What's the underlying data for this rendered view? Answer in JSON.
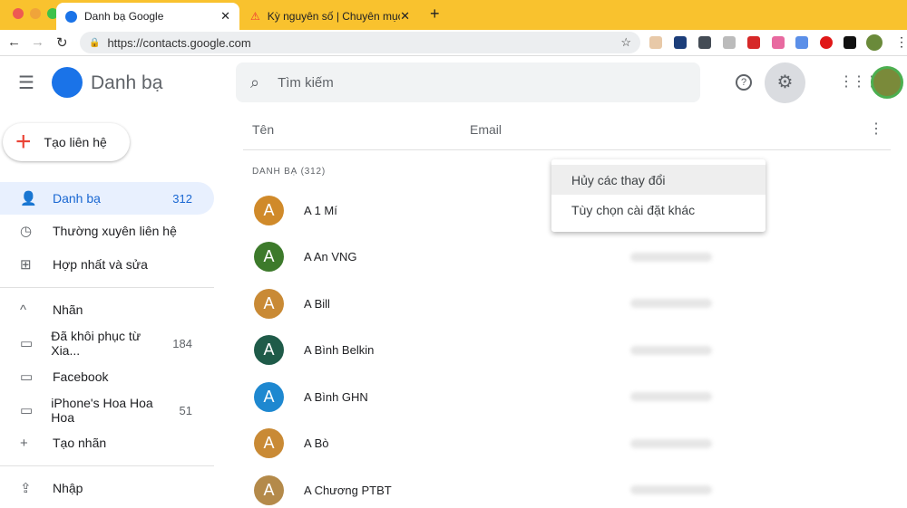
{
  "browser": {
    "tabs": [
      {
        "title": "Danh bạ Google",
        "active": true
      },
      {
        "title": "Kỳ nguyên số | Chuyên mục CN",
        "active": false
      }
    ],
    "url": "https://contacts.google.com"
  },
  "app": {
    "title": "Danh bạ",
    "search_placeholder": "Tìm kiếm",
    "create_label": "Tạo liên hệ"
  },
  "sidebar": {
    "items": [
      {
        "label": "Danh bạ",
        "count": "312",
        "icon": "person-icon"
      },
      {
        "label": "Thường xuyên liên hệ",
        "icon": "history-icon"
      },
      {
        "label": "Hợp nhất và sửa",
        "icon": "merge-icon"
      }
    ],
    "labels_header": "Nhãn",
    "labels": [
      {
        "label": "Đã khôi phục từ Xia...",
        "count": "184"
      },
      {
        "label": "Facebook"
      },
      {
        "label": "iPhone's Hoa Hoa Hoa",
        "count": "51"
      }
    ],
    "create_label": "Tạo nhãn",
    "import": "Nhập"
  },
  "table": {
    "col_name": "Tên",
    "col_email": "Email",
    "section": "DANH BẠ (312)",
    "contacts": [
      {
        "name": "A 1 Mí",
        "initial": "A",
        "color": "#d08a2a"
      },
      {
        "name": "A An VNG",
        "initial": "A",
        "color": "#3d7a2b"
      },
      {
        "name": "A Bill",
        "initial": "A",
        "color": "#c98a35"
      },
      {
        "name": "A Bình Belkin",
        "initial": "A",
        "color": "#1f5b49"
      },
      {
        "name": "A Bình GHN",
        "initial": "A",
        "color": "#1e88d0"
      },
      {
        "name": "A Bò",
        "initial": "A",
        "color": "#c98a35"
      },
      {
        "name": "A Chương PTBT",
        "initial": "A",
        "color": "#b48a4a"
      }
    ]
  },
  "settings_menu": {
    "items": [
      "Hủy các thay đổi",
      "Tùy chọn cài đặt khác"
    ]
  },
  "colors": {
    "accent": "#1a73e8",
    "tabbar": "#f9c22e",
    "selected": "#e8f0fe"
  }
}
